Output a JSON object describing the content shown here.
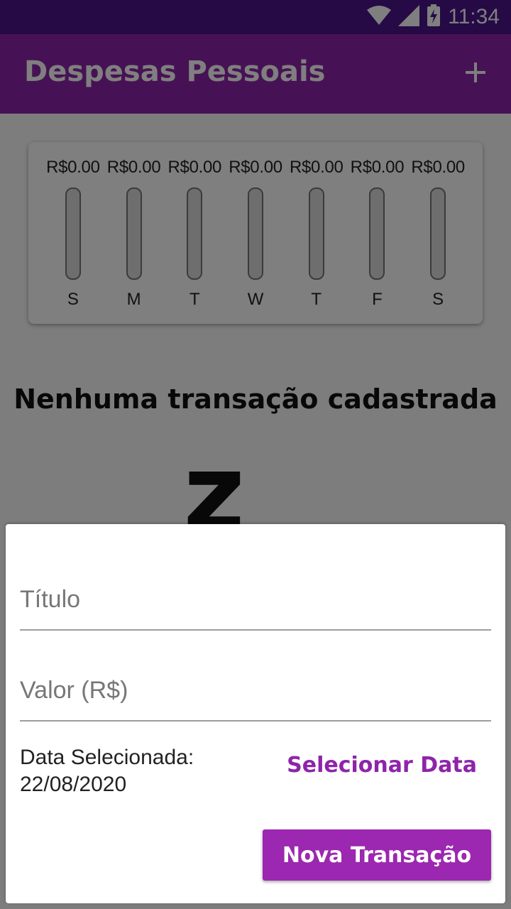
{
  "status_bar": {
    "time": "11:34",
    "icons": [
      "wifi-icon",
      "signal-icon",
      "battery-charging-icon"
    ]
  },
  "app_bar": {
    "title": "Despesas Pessoais",
    "add_icon": "plus-icon"
  },
  "weekly_chart": {
    "bars": [
      {
        "amount": "R$0.00",
        "day": "S",
        "fill_fraction": 0
      },
      {
        "amount": "R$0.00",
        "day": "M",
        "fill_fraction": 0
      },
      {
        "amount": "R$0.00",
        "day": "T",
        "fill_fraction": 0
      },
      {
        "amount": "R$0.00",
        "day": "W",
        "fill_fraction": 0
      },
      {
        "amount": "R$0.00",
        "day": "T",
        "fill_fraction": 0
      },
      {
        "amount": "R$0.00",
        "day": "F",
        "fill_fraction": 0
      },
      {
        "amount": "R$0.00",
        "day": "S",
        "fill_fraction": 0
      }
    ]
  },
  "empty_state": {
    "title": "Nenhuma transação cadastrada",
    "figure": "z"
  },
  "form": {
    "title_field": {
      "placeholder": "Título",
      "value": ""
    },
    "value_field": {
      "placeholder": "Valor (R$)",
      "value": ""
    },
    "date_label_line1": "Data Selecionada:",
    "date_label_line2": "22/08/2020",
    "select_date_label": "Selecionar Data",
    "submit_label": "Nova Transação"
  },
  "colors": {
    "primary": "#8e24aa",
    "primary_dark": "#4a148c",
    "button": "#9c27b0"
  }
}
